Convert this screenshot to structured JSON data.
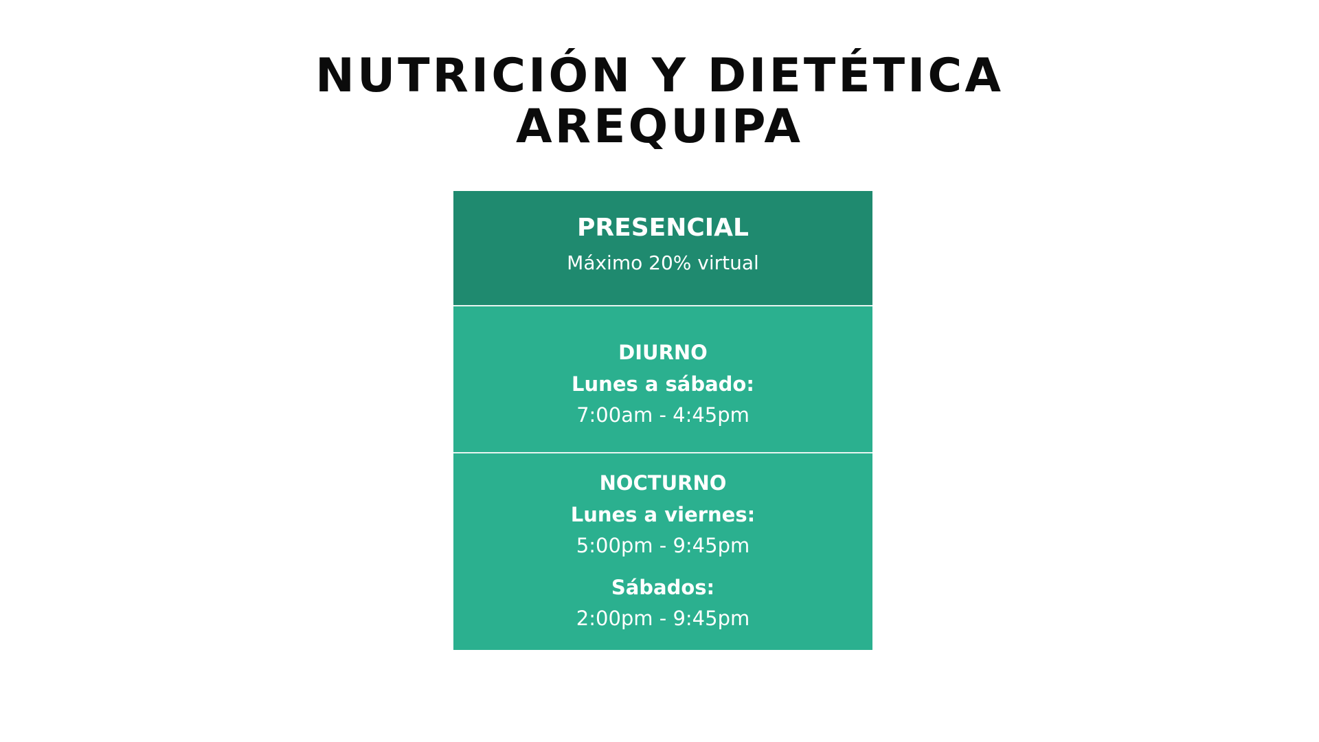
{
  "title": {
    "line1": "NUTRICIÓN Y DIETÉTICA",
    "line2": "AREQUIPA"
  },
  "modality": {
    "name": "PRESENCIAL",
    "note": "Máximo 20% virtual"
  },
  "diurno": {
    "name": "DIURNO",
    "days": "Lunes a sábado:",
    "hours": "7:00am - 4:45pm"
  },
  "nocturno": {
    "name": "NOCTURNO",
    "weekday_days": "Lunes a viernes:",
    "weekday_hours": "5:00pm - 9:45pm",
    "saturday_days": "Sábados:",
    "saturday_hours": "2:00pm - 9:45pm"
  },
  "colors": {
    "header_bg": "#1f8a6f",
    "cell_bg": "#2bb08f",
    "text_light": "#ffffff",
    "title_text": "#0b0b0b"
  }
}
